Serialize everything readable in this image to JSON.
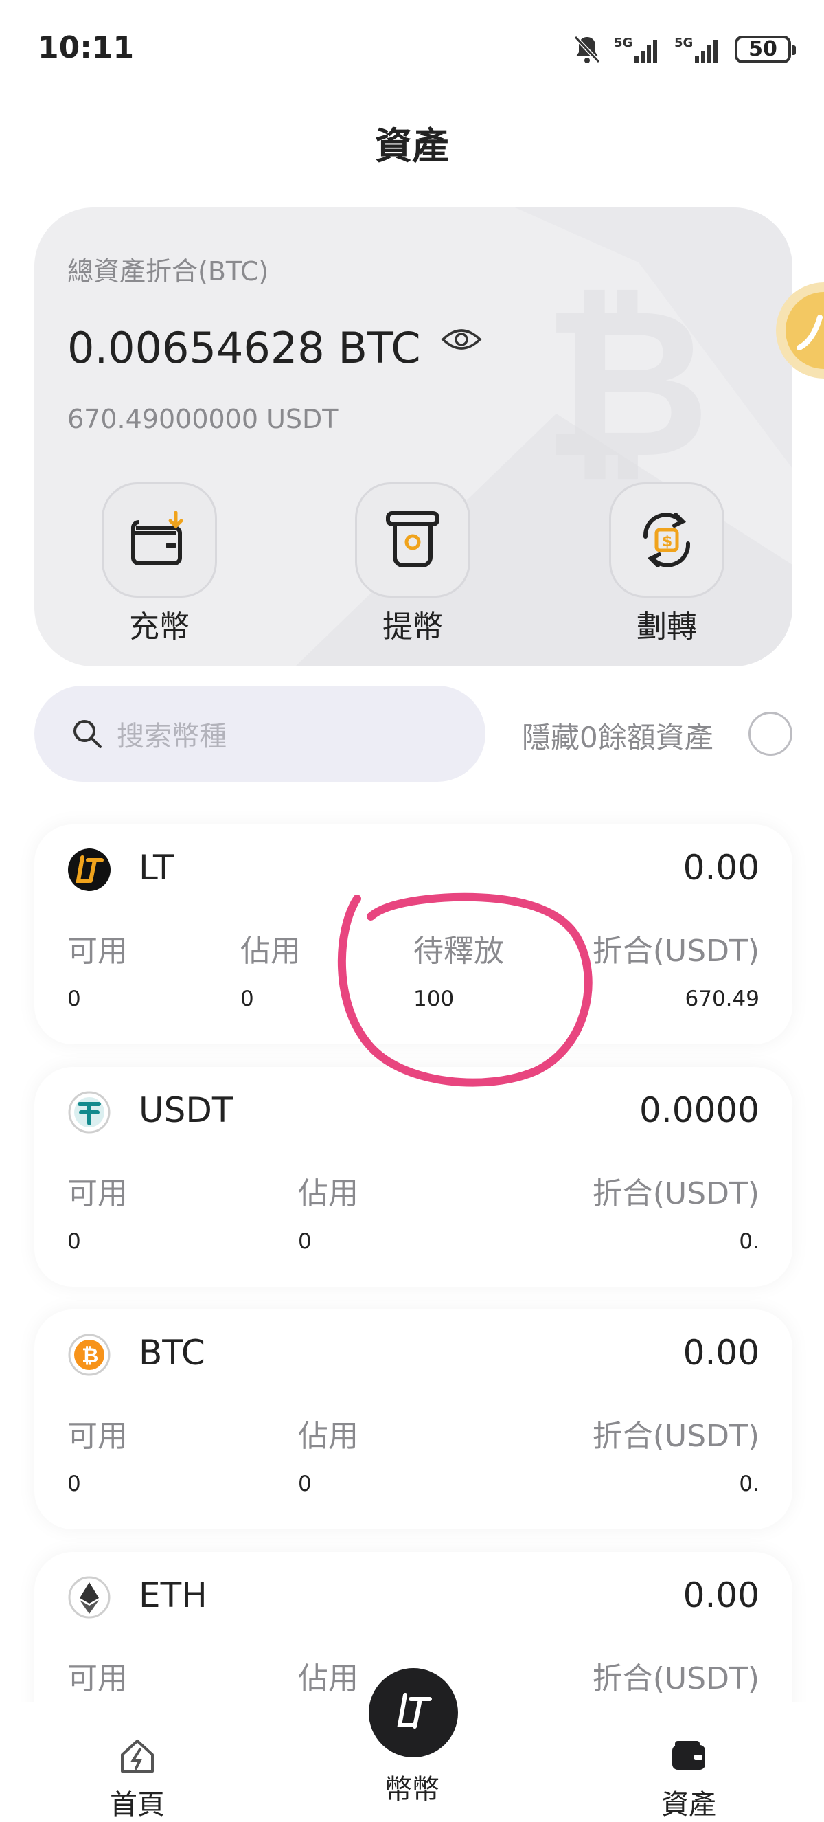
{
  "status_bar": {
    "time": "10:11",
    "network_1": "5G",
    "network_2": "5G",
    "battery": "50"
  },
  "page": {
    "title": "資產"
  },
  "summary": {
    "label": "總資產折合(BTC)",
    "total_btc": "0.00654628 BTC",
    "total_usdt": "670.49000000 USDT",
    "actions": [
      {
        "label": "充幣",
        "icon": "deposit-wallet-icon"
      },
      {
        "label": "提幣",
        "icon": "withdraw-atm-icon"
      },
      {
        "label": "劃轉",
        "icon": "transfer-exchange-icon"
      }
    ]
  },
  "search": {
    "placeholder": "搜索幣種"
  },
  "hide_zero": {
    "label": "隱藏0餘額資產",
    "checked": false
  },
  "assets": [
    {
      "symbol": "LT",
      "total": "0.00",
      "icon": "lt-logo-icon",
      "columns": [
        {
          "label": "可用",
          "value": "0"
        },
        {
          "label": "佔用",
          "value": "0"
        },
        {
          "label": "待釋放",
          "value": "100"
        },
        {
          "label": "折合(USDT)",
          "value": "670.49"
        }
      ]
    },
    {
      "symbol": "USDT",
      "total": "0.0000",
      "icon": "tether-icon",
      "columns": [
        {
          "label": "可用",
          "value": "0"
        },
        {
          "label": "佔用",
          "value": "0"
        },
        {
          "label": "折合(USDT)",
          "value": "0."
        }
      ]
    },
    {
      "symbol": "BTC",
      "total": "0.00",
      "icon": "bitcoin-icon",
      "columns": [
        {
          "label": "可用",
          "value": "0"
        },
        {
          "label": "佔用",
          "value": "0"
        },
        {
          "label": "折合(USDT)",
          "value": "0."
        }
      ]
    },
    {
      "symbol": "ETH",
      "total": "0.00",
      "icon": "ethereum-icon",
      "columns": [
        {
          "label": "可用",
          "value": ""
        },
        {
          "label": "佔用",
          "value": ""
        },
        {
          "label": "折合(USDT)",
          "value": ""
        }
      ]
    }
  ],
  "nav": [
    {
      "label": "首頁",
      "icon": "home-icon"
    },
    {
      "label": "幣幣",
      "icon": "lt-logo-icon"
    },
    {
      "label": "資產",
      "icon": "wallet-icon"
    }
  ],
  "colors": {
    "accent": "#f0a31c",
    "annotation": "#e8457f",
    "card_bg": "#eeeef0",
    "search_bg": "#ededf5"
  }
}
